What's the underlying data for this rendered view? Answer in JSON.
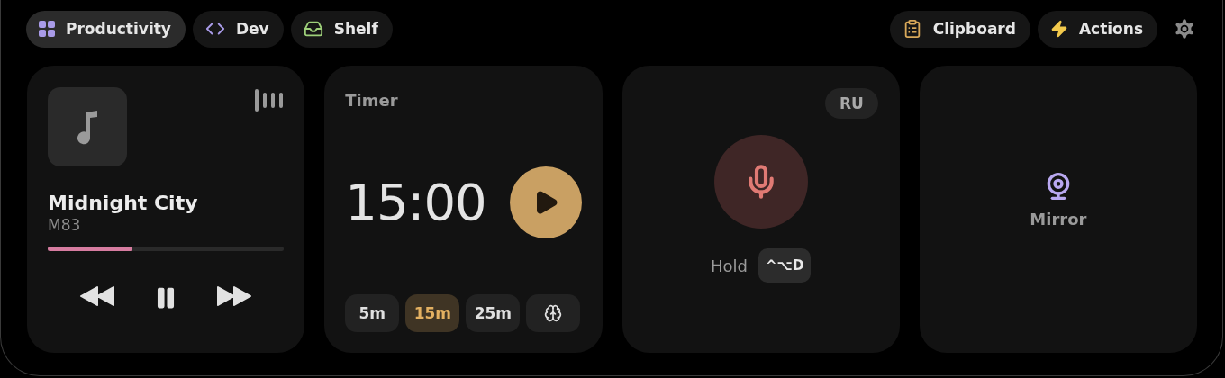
{
  "tabs": [
    {
      "label": "Productivity",
      "kind": "grid",
      "selected": true
    },
    {
      "label": "Dev",
      "kind": "code",
      "selected": false
    },
    {
      "label": "Shelf",
      "kind": "tray",
      "selected": false
    }
  ],
  "actions": [
    {
      "label": "Clipboard",
      "kind": "clipboard"
    },
    {
      "label": "Actions",
      "kind": "bolt"
    }
  ],
  "player": {
    "title": "Midnight City",
    "artist": "M83",
    "level": 0.36,
    "playing": true
  },
  "timer": {
    "title": "Timer",
    "time": "15:00",
    "presets": [
      {
        "kind": "text",
        "label": "5m",
        "selected": false
      },
      {
        "kind": "text",
        "label": "15m",
        "selected": true
      },
      {
        "kind": "text",
        "label": "25m",
        "selected": false
      },
      {
        "kind": "focus",
        "selected": false
      }
    ]
  },
  "dictation": {
    "language": "RU",
    "hint": "Hold",
    "shortcut": "^⌥D",
    "recording": false
  },
  "mirror": {
    "label": "Mirror"
  }
}
